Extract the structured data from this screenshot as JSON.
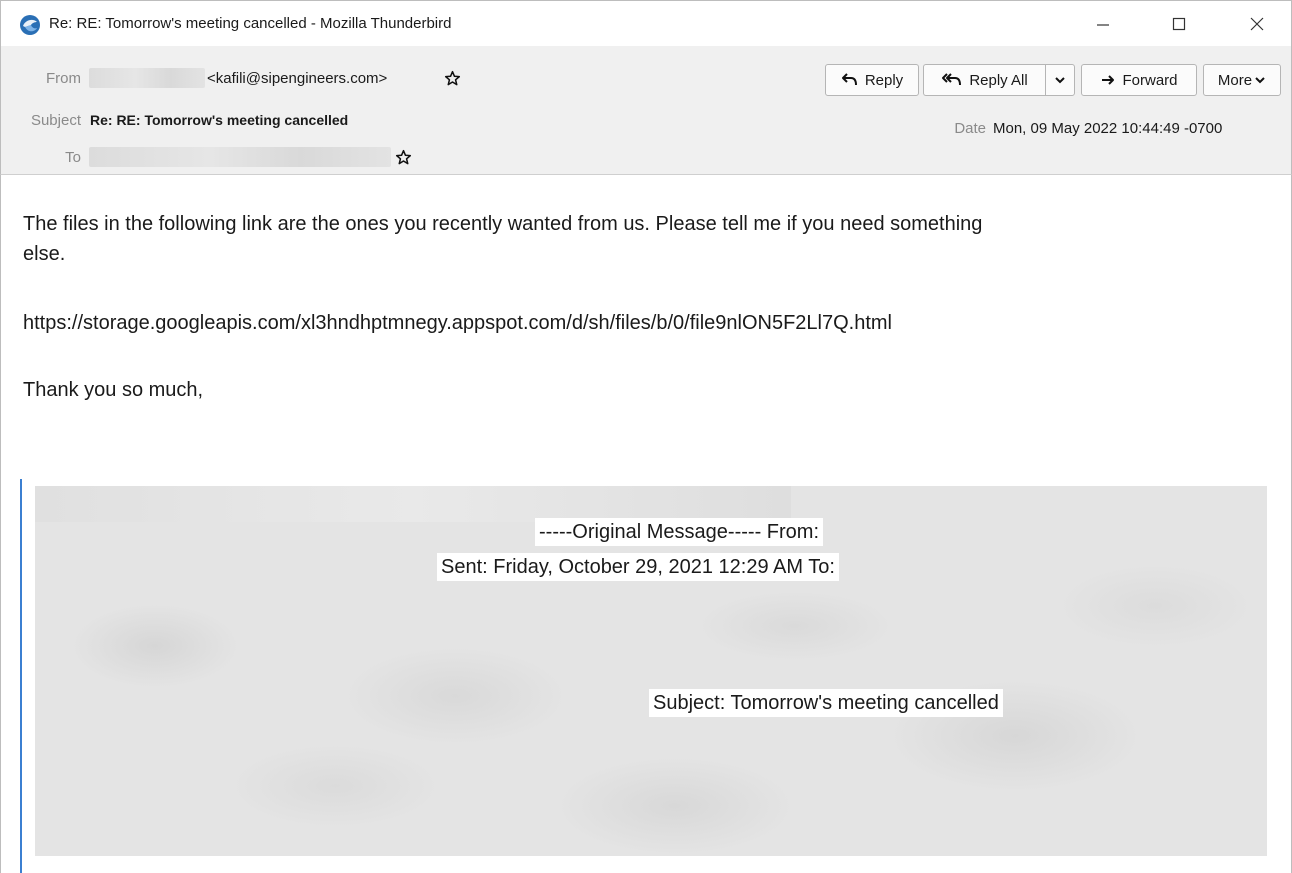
{
  "window": {
    "title": "Re: RE: Tomorrow's meeting cancelled - Mozilla Thunderbird"
  },
  "header": {
    "from_label": "From",
    "from_address": "<kafili@sipengineers.com>",
    "subject_label": "Subject",
    "subject_value": "Re: RE: Tomorrow's meeting cancelled",
    "to_label": "To",
    "date_label": "Date",
    "date_value": "Mon, 09 May 2022 10:44:49 -0700"
  },
  "toolbar": {
    "reply": "Reply",
    "reply_all": "Reply All",
    "forward": "Forward",
    "more": "More"
  },
  "body": {
    "line1": "The files in the following link are the ones you recently wanted from us. Please tell me if you need something",
    "line2": "else.",
    "link": "https://storage.googleapis.com/xl3hndhptmnegy.appspot.com/d/sh/files/b/0/file9nlON5F2Ll7Q.html",
    "closing": "Thank you so much,"
  },
  "quoted": {
    "original_message": "-----Original Message----- From:",
    "sent": "Sent: Friday, October 29, 2021 12:29 AM To:",
    "subject": "Subject: Tomorrow's meeting cancelled"
  },
  "colors": {
    "header_bg": "#f0f0f0",
    "quote_bar": "#3b7fd1",
    "app_icon": "#2a6fb5"
  }
}
